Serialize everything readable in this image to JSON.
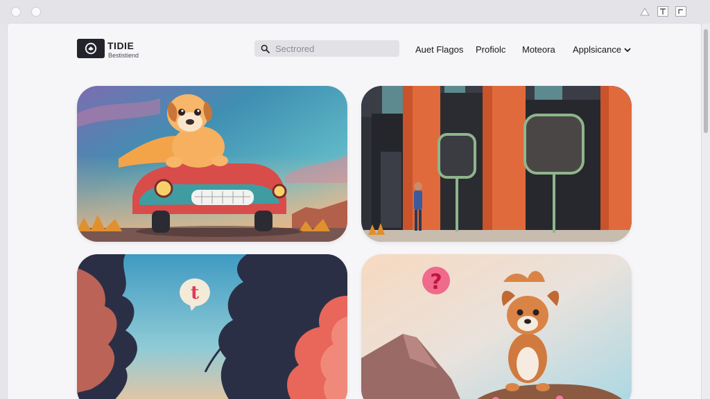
{
  "brand": {
    "title": "TIDIE",
    "subtitle": "Bestistiend"
  },
  "search": {
    "placeholder": "Sectrored",
    "icon": "search-icon"
  },
  "nav": {
    "items": [
      {
        "label": "Auet Flagos"
      },
      {
        "label": "Profiolc"
      },
      {
        "label": "Moteora"
      },
      {
        "label": "Applsicance",
        "icon": "chevron-down-icon"
      }
    ]
  },
  "chrome": {
    "controls": [
      "triangle-icon",
      "text-icon",
      "corner-icon"
    ]
  },
  "cards": [
    {
      "subject": "dog-in-car-scene"
    },
    {
      "subject": "orange-building-street-scene"
    },
    {
      "subject": "sky-clouds-speech-bubble-scene"
    },
    {
      "subject": "dog-on-hill-question-scene"
    }
  ],
  "bubble_glyph": "t",
  "colors": {
    "accent_pink": "#e0395a",
    "dark_ui": "#23242b"
  }
}
